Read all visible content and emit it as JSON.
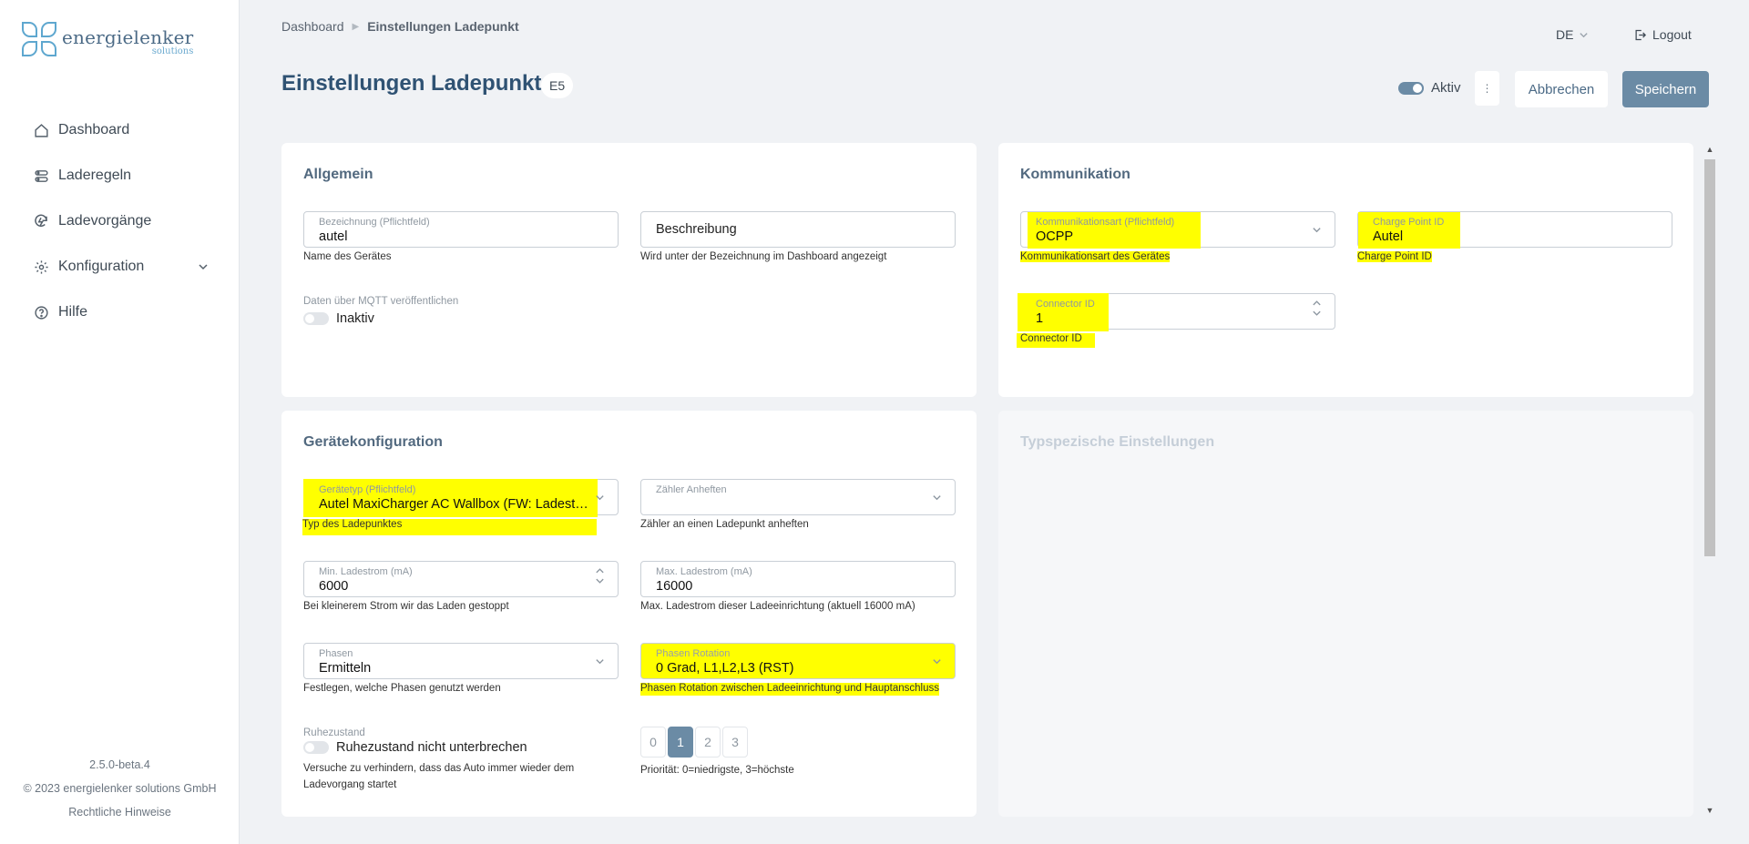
{
  "brand": {
    "name": "energielenker",
    "sub": "solutions"
  },
  "nav": {
    "items": [
      {
        "label": "Dashboard",
        "icon": "home-icon"
      },
      {
        "label": "Laderegeln",
        "icon": "rules-icon"
      },
      {
        "label": "Ladevorgänge",
        "icon": "charging-icon"
      },
      {
        "label": "Konfiguration",
        "icon": "gear-icon"
      },
      {
        "label": "Hilfe",
        "icon": "help-icon"
      }
    ]
  },
  "footer": {
    "version": "2.5.0-beta.4",
    "copyright": "© 2023 energielenker solutions GmbH",
    "legal": "Rechtliche Hinweise"
  },
  "header": {
    "breadcrumb": [
      "Dashboard",
      "Einstellungen Ladepunkt"
    ],
    "language": "DE",
    "logout": "Logout",
    "title": "Einstellungen Ladepunkt",
    "badge": "E5",
    "active_label": "Aktiv",
    "cancel_label": "Abbrechen",
    "save_label": "Speichern"
  },
  "general": {
    "title": "Allgemein",
    "name": {
      "label": "Bezeichnung (Pflichtfeld)",
      "value": "autel",
      "hint": "Name des Gerätes"
    },
    "description": {
      "placeholder": "Beschreibung",
      "hint": "Wird unter der Bezeichnung im Dashboard angezeigt"
    },
    "mqtt": {
      "label": "Daten über MQTT veröffentlichen",
      "state": "Inaktiv"
    }
  },
  "communication": {
    "title": "Kommunikation",
    "type": {
      "label": "Kommunikationsart (Pflichtfeld)",
      "value": "OCPP",
      "hint": "Kommunikationsart des Gerätes"
    },
    "cpid": {
      "label": "Charge Point ID",
      "value": "Autel",
      "hint": "Charge Point ID"
    },
    "connector": {
      "label": "Connector ID",
      "value": "1",
      "hint": "Connector ID"
    }
  },
  "device": {
    "title": "Gerätekonfiguration",
    "device_type": {
      "label": "Gerätetyp (Pflichtfeld)",
      "value": "Autel MaxiCharger AC Wallbox (FW: Ladesteu...",
      "hint": "Typ des Ladepunktes"
    },
    "meter": {
      "label": "Zähler Anheften",
      "hint": "Zähler an einen Ladepunkt anheften"
    },
    "min_current": {
      "label": "Min. Ladestrom (mA)",
      "value": "6000",
      "hint": "Bei kleinerem Strom wir das Laden gestoppt"
    },
    "max_current": {
      "label": "Max. Ladestrom (mA)",
      "value": "16000",
      "hint": "Max. Ladestrom dieser Ladeeinrichtung (aktuell 16000 mA)"
    },
    "phases": {
      "label": "Phasen",
      "value": "Ermitteln",
      "hint": "Festlegen, welche Phasen genutzt werden"
    },
    "rotation": {
      "label": "Phasen Rotation",
      "value": "0 Grad, L1,L2,L3 (RST)",
      "hint": "Phasen Rotation zwischen Ladeeinrichtung und Hauptanschluss"
    },
    "rest": {
      "label": "Ruhezustand",
      "toggle": "Ruhezustand nicht unterbrechen",
      "hint": "Versuche zu verhindern, dass das Auto immer wieder dem Ladevorgang startet"
    },
    "priority": {
      "options": [
        "0",
        "1",
        "2",
        "3"
      ],
      "selected": "1",
      "hint": "Priorität: 0=niedrigste, 3=höchste"
    }
  },
  "type_specific": {
    "title": "Typspezische Einstellungen"
  },
  "colors": {
    "accent": "#6b8ba5",
    "title": "#2f5273",
    "highlight": "#ffff00"
  }
}
